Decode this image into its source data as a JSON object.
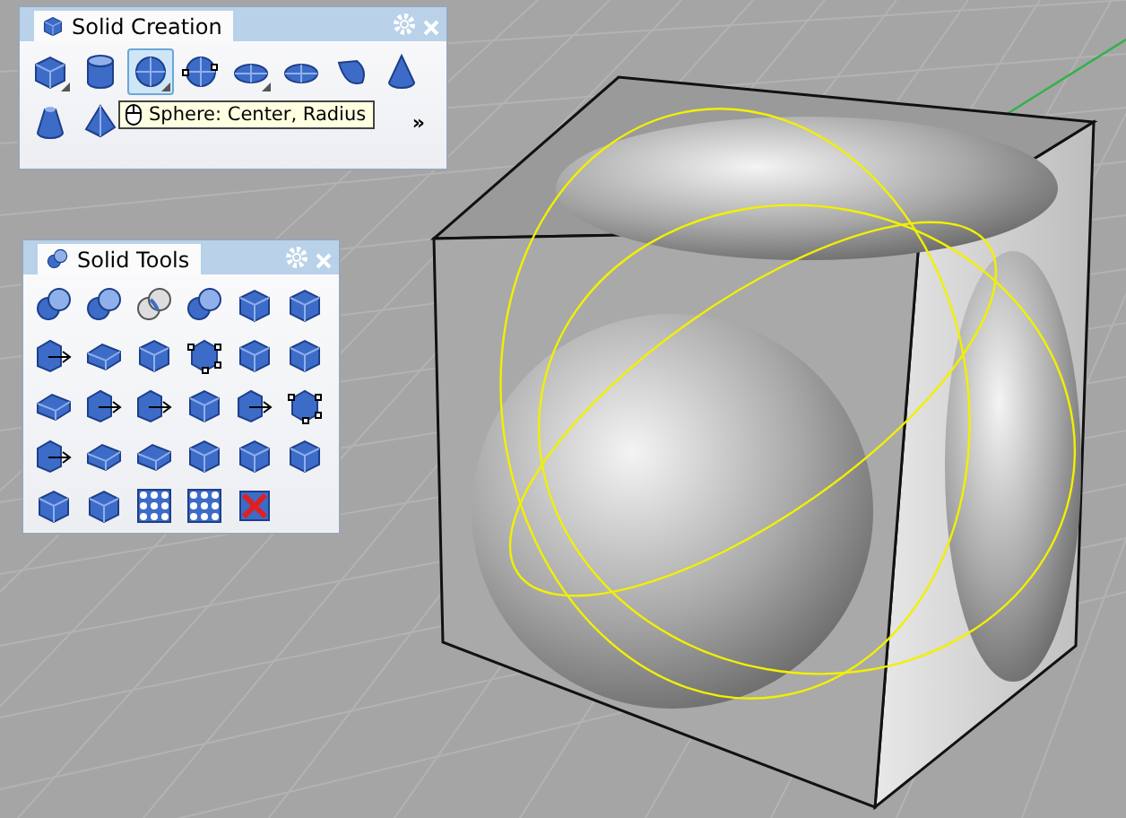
{
  "toolbars": [
    {
      "title": "Solid Creation",
      "overflow": "»",
      "tooltip": "Sphere: Center, Radius",
      "buttons": [
        {
          "kind": "cube",
          "flyout": true,
          "selected": false
        },
        {
          "kind": "cylinder",
          "flyout": false,
          "selected": false
        },
        {
          "kind": "sphere",
          "flyout": true,
          "selected": true
        },
        {
          "kind": "sphere-points",
          "flyout": false,
          "selected": false
        },
        {
          "kind": "ellipsoid",
          "flyout": true,
          "selected": false
        },
        {
          "kind": "ellipsoid",
          "flyout": false,
          "selected": false
        },
        {
          "kind": "bowl",
          "flyout": false,
          "selected": false
        },
        {
          "kind": "cone",
          "flyout": false,
          "selected": false
        },
        {
          "kind": "truncated-cone",
          "flyout": false,
          "selected": false
        },
        {
          "kind": "pyramid",
          "flyout": false,
          "selected": false
        }
      ]
    },
    {
      "title": "Solid Tools",
      "buttons": [
        {
          "kind": "sphere-pair",
          "selected": false
        },
        {
          "kind": "sphere-pair",
          "selected": false
        },
        {
          "kind": "sphere-pair-outline",
          "selected": false
        },
        {
          "kind": "sphere-pair",
          "selected": false
        },
        {
          "kind": "cube",
          "selected": false
        },
        {
          "kind": "cube",
          "selected": false
        },
        {
          "kind": "cube-arrow",
          "selected": false
        },
        {
          "kind": "plate",
          "selected": false
        },
        {
          "kind": "cube",
          "selected": false
        },
        {
          "kind": "cube-points",
          "selected": false
        },
        {
          "kind": "cube",
          "selected": false
        },
        {
          "kind": "cube",
          "selected": false
        },
        {
          "kind": "plate",
          "selected": false
        },
        {
          "kind": "cube-arrow",
          "selected": false
        },
        {
          "kind": "cube-arrow",
          "selected": false
        },
        {
          "kind": "cube",
          "selected": false
        },
        {
          "kind": "cube-arrow",
          "selected": false
        },
        {
          "kind": "cube-points",
          "selected": false
        },
        {
          "kind": "cube-arrow",
          "selected": false
        },
        {
          "kind": "plate",
          "selected": false
        },
        {
          "kind": "plate",
          "selected": false
        },
        {
          "kind": "cube",
          "selected": false
        },
        {
          "kind": "cube",
          "selected": false
        },
        {
          "kind": "cube",
          "selected": false
        },
        {
          "kind": "cube",
          "selected": false
        },
        {
          "kind": "cube",
          "selected": false
        },
        {
          "kind": "grid-dots",
          "selected": false
        },
        {
          "kind": "grid-dots",
          "selected": false
        },
        {
          "kind": "delete",
          "selected": false
        }
      ]
    }
  ]
}
